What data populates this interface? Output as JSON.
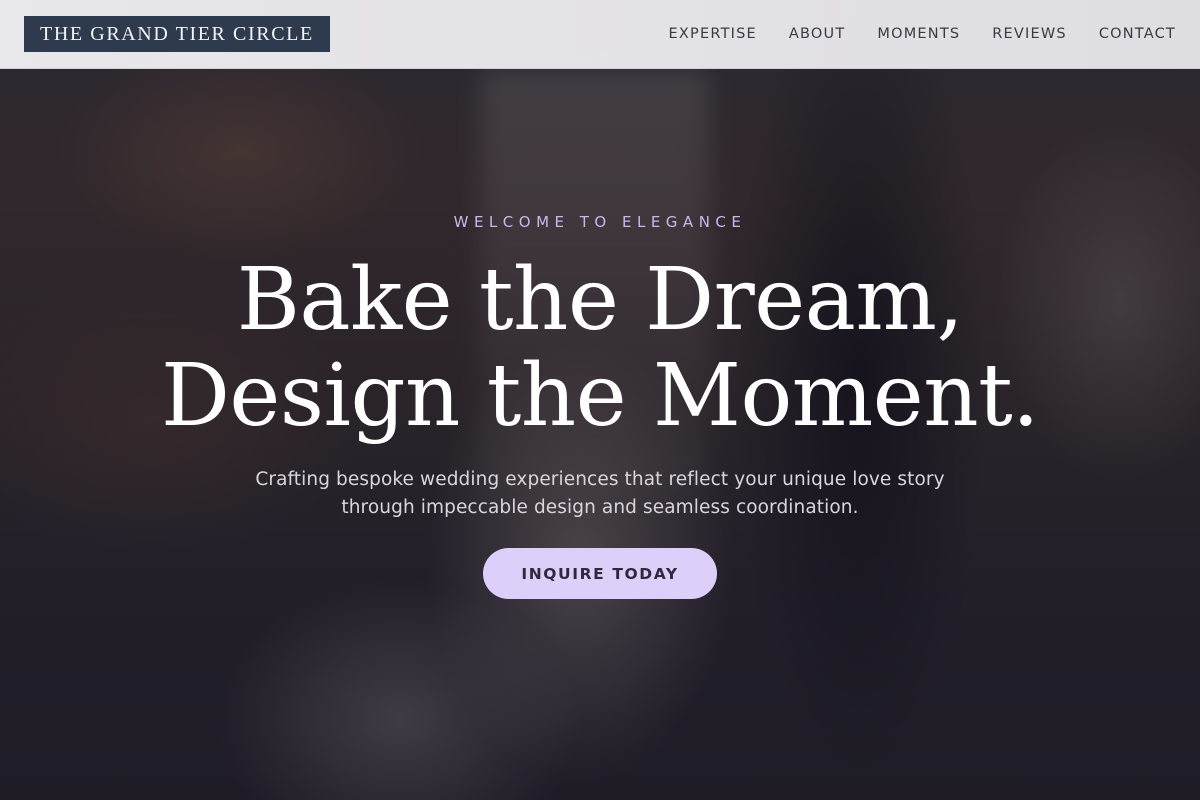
{
  "header": {
    "logo_text": "THE GRAND TIER CIRCLE",
    "nav": [
      {
        "label": "EXPERTISE"
      },
      {
        "label": "ABOUT"
      },
      {
        "label": "MOMENTS"
      },
      {
        "label": "REVIEWS"
      },
      {
        "label": "CONTACT"
      }
    ]
  },
  "hero": {
    "eyebrow": "WELCOME TO ELEGANCE",
    "headline_line1": "Bake the Dream,",
    "headline_line2": "Design the Moment.",
    "subtitle": "Crafting bespoke wedding experiences that reflect your unique love story through impeccable design and seamless coordination.",
    "cta_label": "INQUIRE TODAY"
  },
  "colors": {
    "logo_background": "#2e3a4e",
    "accent_lavender": "#dcd0fb",
    "eyebrow_text": "#c9b8ea"
  }
}
